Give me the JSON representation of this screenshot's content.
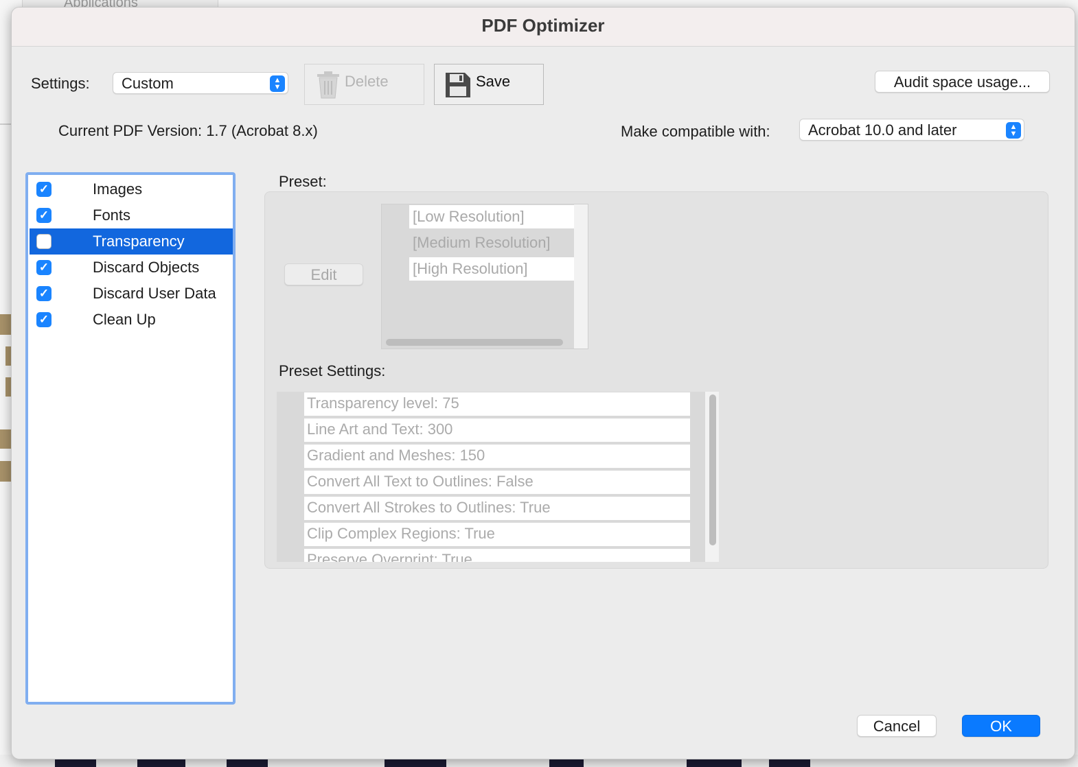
{
  "background": {
    "tab_label": "Applications"
  },
  "dialog": {
    "title": "PDF Optimizer",
    "settings_label": "Settings:",
    "settings_value": "Custom",
    "delete_label": "Delete",
    "save_label": "Save",
    "audit_label": "Audit space usage...",
    "current_version": "Current PDF Version: 1.7 (Acrobat 8.x)",
    "compat_label": "Make compatible with:",
    "compat_value": "Acrobat 10.0 and later",
    "categories": [
      {
        "label": "Images",
        "checked": true
      },
      {
        "label": "Fonts",
        "checked": true
      },
      {
        "label": "Transparency",
        "checked": false,
        "selected": true
      },
      {
        "label": "Discard Objects",
        "checked": true
      },
      {
        "label": "Discard User Data",
        "checked": true
      },
      {
        "label": "Clean Up",
        "checked": true
      }
    ],
    "preset_label": "Preset:",
    "edit_label": "Edit",
    "presets": [
      "[Low Resolution]",
      "[Medium Resolution]",
      "[High Resolution]"
    ],
    "preset_settings_label": "Preset Settings:",
    "preset_settings": [
      "Transparency level: 75",
      "Line Art and Text: 300",
      "Gradient and Meshes: 150",
      "Convert All Text to Outlines: False",
      "Convert All Strokes to Outlines: True",
      "Clip Complex Regions: True",
      "Preserve Overprint: True"
    ],
    "cancel_label": "Cancel",
    "ok_label": "OK"
  },
  "colors": {
    "accent": "#0a7aff",
    "selection": "#1267de",
    "focus_ring": "#80aef0"
  }
}
